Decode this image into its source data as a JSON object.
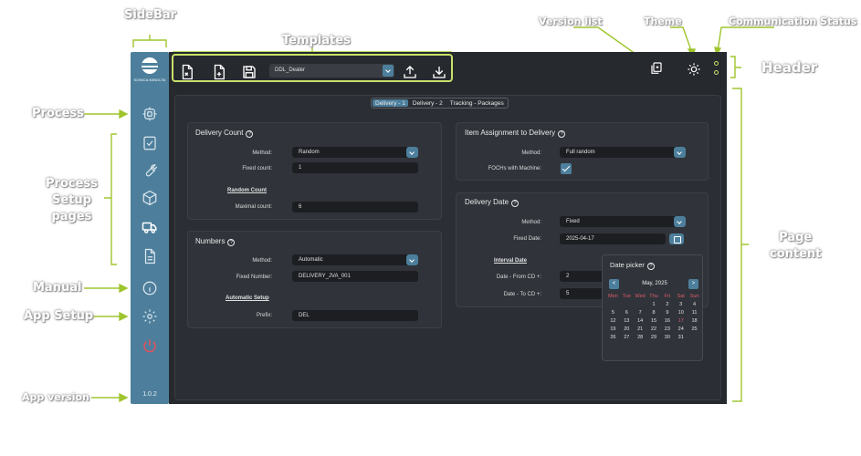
{
  "annotations": {
    "sidebar": "SideBar",
    "templates": "Templates",
    "version_list": "Version list",
    "theme": "Theme",
    "communication_status": "Communication Status",
    "header": "Header",
    "process": "Process",
    "process_setup_pages": [
      "Process",
      "Setup",
      "pages"
    ],
    "manual": "Manual",
    "app_setup": "App Setup",
    "app_version": "App version",
    "page_content": [
      "Page",
      "content"
    ]
  },
  "sidebar": {
    "logo_text": "KONICA MINOLTA",
    "items": [
      {
        "icon": "process-icon"
      },
      {
        "icon": "checklist-icon"
      },
      {
        "icon": "wrench-icon"
      },
      {
        "icon": "package-icon"
      },
      {
        "icon": "truck-icon",
        "active": true
      },
      {
        "icon": "document-icon"
      },
      {
        "icon": "info-icon"
      },
      {
        "icon": "gear-icon"
      },
      {
        "icon": "power-icon"
      }
    ],
    "version": "1.0.2"
  },
  "header": {
    "template_select": "DDL_Dealer",
    "buttons": [
      "import-icon",
      "new-template-icon",
      "save-icon",
      "upload-icon",
      "download-icon"
    ],
    "right_icons": [
      "version-list-icon",
      "theme-icon"
    ]
  },
  "tabs": [
    {
      "label": "Delivery - 1",
      "active": true
    },
    {
      "label": "Delivery - 2",
      "active": false
    },
    {
      "label": "Tracking - Packages",
      "active": false
    }
  ],
  "delivery_count": {
    "title": "Delivery Count",
    "method_label": "Method:",
    "method_value": "Random",
    "fixed_count_label": "Fixed count:",
    "fixed_count_value": "1",
    "random_count_label": "Random Count",
    "maximal_count_label": "Maximal count:",
    "maximal_count_value": "6"
  },
  "numbers": {
    "title": "Numbers",
    "method_label": "Method:",
    "method_value": "Automatic",
    "fixed_number_label": "Fixed Number:",
    "fixed_number_value": "DELIVERY_JVA_001",
    "automatic_setup_label": "Automatic Setup",
    "prefix_label": "Prefix:",
    "prefix_value": "DEL"
  },
  "item_assignment": {
    "title": "Item Assignment to Delivery",
    "method_label": "Method:",
    "method_value": "Full random",
    "fochs_label": "FOCHs with Machine:",
    "fochs_checked": true
  },
  "delivery_date": {
    "title": "Delivery Date",
    "method_label": "Method:",
    "method_value": "Fixed",
    "fixed_date_label": "Fixed Date:",
    "fixed_date_value": "2025-04-17",
    "interval_label": "Interval Date",
    "date_from_label": "Date - From CD +:",
    "date_from_value": "2",
    "date_to_label": "Date - To CD +:",
    "date_to_value": "5"
  },
  "date_picker": {
    "title": "Date picker",
    "month": "May, 2025",
    "prev": "<",
    "next": ">",
    "weekdays": [
      "Mon",
      "Tue",
      "Wed",
      "Thu",
      "Fri",
      "Sat",
      "Sun"
    ],
    "days": [
      "",
      "",
      "",
      "1",
      "2",
      "3",
      "4",
      "5",
      "6",
      "7",
      "8",
      "9",
      "10",
      "11",
      "12",
      "13",
      "14",
      "15",
      "16",
      "17",
      "18",
      "19",
      "20",
      "21",
      "22",
      "23",
      "24",
      "25",
      "26",
      "27",
      "28",
      "29",
      "30",
      "31",
      "",
      "",
      ""
    ],
    "highlight_day": "17"
  },
  "colors": {
    "accent": "#4d7f9c",
    "annotation_line": "#9fc52e",
    "header_bg": "#26292e",
    "panel_bg": "#30343a"
  }
}
